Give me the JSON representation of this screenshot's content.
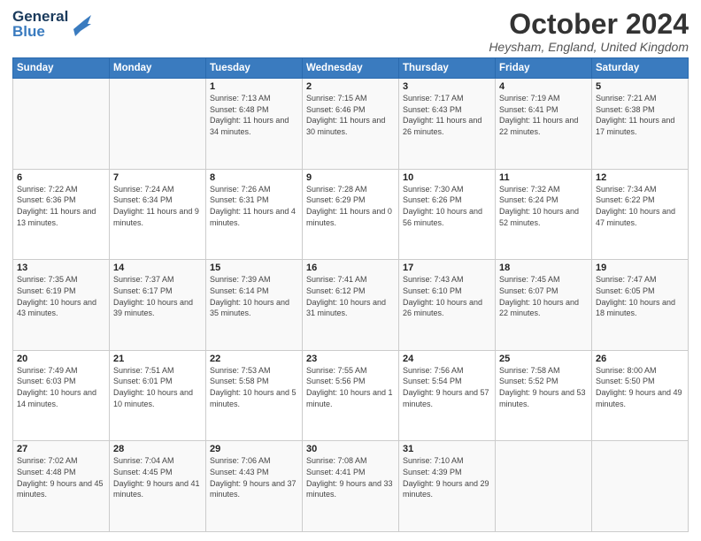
{
  "header": {
    "logo_line1": "General",
    "logo_line2": "Blue",
    "month_title": "October 2024",
    "location": "Heysham, England, United Kingdom"
  },
  "days_of_week": [
    "Sunday",
    "Monday",
    "Tuesday",
    "Wednesday",
    "Thursday",
    "Friday",
    "Saturday"
  ],
  "weeks": [
    [
      {
        "day": "",
        "sunrise": "",
        "sunset": "",
        "daylight": ""
      },
      {
        "day": "",
        "sunrise": "",
        "sunset": "",
        "daylight": ""
      },
      {
        "day": "1",
        "sunrise": "Sunrise: 7:13 AM",
        "sunset": "Sunset: 6:48 PM",
        "daylight": "Daylight: 11 hours and 34 minutes."
      },
      {
        "day": "2",
        "sunrise": "Sunrise: 7:15 AM",
        "sunset": "Sunset: 6:46 PM",
        "daylight": "Daylight: 11 hours and 30 minutes."
      },
      {
        "day": "3",
        "sunrise": "Sunrise: 7:17 AM",
        "sunset": "Sunset: 6:43 PM",
        "daylight": "Daylight: 11 hours and 26 minutes."
      },
      {
        "day": "4",
        "sunrise": "Sunrise: 7:19 AM",
        "sunset": "Sunset: 6:41 PM",
        "daylight": "Daylight: 11 hours and 22 minutes."
      },
      {
        "day": "5",
        "sunrise": "Sunrise: 7:21 AM",
        "sunset": "Sunset: 6:38 PM",
        "daylight": "Daylight: 11 hours and 17 minutes."
      }
    ],
    [
      {
        "day": "6",
        "sunrise": "Sunrise: 7:22 AM",
        "sunset": "Sunset: 6:36 PM",
        "daylight": "Daylight: 11 hours and 13 minutes."
      },
      {
        "day": "7",
        "sunrise": "Sunrise: 7:24 AM",
        "sunset": "Sunset: 6:34 PM",
        "daylight": "Daylight: 11 hours and 9 minutes."
      },
      {
        "day": "8",
        "sunrise": "Sunrise: 7:26 AM",
        "sunset": "Sunset: 6:31 PM",
        "daylight": "Daylight: 11 hours and 4 minutes."
      },
      {
        "day": "9",
        "sunrise": "Sunrise: 7:28 AM",
        "sunset": "Sunset: 6:29 PM",
        "daylight": "Daylight: 11 hours and 0 minutes."
      },
      {
        "day": "10",
        "sunrise": "Sunrise: 7:30 AM",
        "sunset": "Sunset: 6:26 PM",
        "daylight": "Daylight: 10 hours and 56 minutes."
      },
      {
        "day": "11",
        "sunrise": "Sunrise: 7:32 AM",
        "sunset": "Sunset: 6:24 PM",
        "daylight": "Daylight: 10 hours and 52 minutes."
      },
      {
        "day": "12",
        "sunrise": "Sunrise: 7:34 AM",
        "sunset": "Sunset: 6:22 PM",
        "daylight": "Daylight: 10 hours and 47 minutes."
      }
    ],
    [
      {
        "day": "13",
        "sunrise": "Sunrise: 7:35 AM",
        "sunset": "Sunset: 6:19 PM",
        "daylight": "Daylight: 10 hours and 43 minutes."
      },
      {
        "day": "14",
        "sunrise": "Sunrise: 7:37 AM",
        "sunset": "Sunset: 6:17 PM",
        "daylight": "Daylight: 10 hours and 39 minutes."
      },
      {
        "day": "15",
        "sunrise": "Sunrise: 7:39 AM",
        "sunset": "Sunset: 6:14 PM",
        "daylight": "Daylight: 10 hours and 35 minutes."
      },
      {
        "day": "16",
        "sunrise": "Sunrise: 7:41 AM",
        "sunset": "Sunset: 6:12 PM",
        "daylight": "Daylight: 10 hours and 31 minutes."
      },
      {
        "day": "17",
        "sunrise": "Sunrise: 7:43 AM",
        "sunset": "Sunset: 6:10 PM",
        "daylight": "Daylight: 10 hours and 26 minutes."
      },
      {
        "day": "18",
        "sunrise": "Sunrise: 7:45 AM",
        "sunset": "Sunset: 6:07 PM",
        "daylight": "Daylight: 10 hours and 22 minutes."
      },
      {
        "day": "19",
        "sunrise": "Sunrise: 7:47 AM",
        "sunset": "Sunset: 6:05 PM",
        "daylight": "Daylight: 10 hours and 18 minutes."
      }
    ],
    [
      {
        "day": "20",
        "sunrise": "Sunrise: 7:49 AM",
        "sunset": "Sunset: 6:03 PM",
        "daylight": "Daylight: 10 hours and 14 minutes."
      },
      {
        "day": "21",
        "sunrise": "Sunrise: 7:51 AM",
        "sunset": "Sunset: 6:01 PM",
        "daylight": "Daylight: 10 hours and 10 minutes."
      },
      {
        "day": "22",
        "sunrise": "Sunrise: 7:53 AM",
        "sunset": "Sunset: 5:58 PM",
        "daylight": "Daylight: 10 hours and 5 minutes."
      },
      {
        "day": "23",
        "sunrise": "Sunrise: 7:55 AM",
        "sunset": "Sunset: 5:56 PM",
        "daylight": "Daylight: 10 hours and 1 minute."
      },
      {
        "day": "24",
        "sunrise": "Sunrise: 7:56 AM",
        "sunset": "Sunset: 5:54 PM",
        "daylight": "Daylight: 9 hours and 57 minutes."
      },
      {
        "day": "25",
        "sunrise": "Sunrise: 7:58 AM",
        "sunset": "Sunset: 5:52 PM",
        "daylight": "Daylight: 9 hours and 53 minutes."
      },
      {
        "day": "26",
        "sunrise": "Sunrise: 8:00 AM",
        "sunset": "Sunset: 5:50 PM",
        "daylight": "Daylight: 9 hours and 49 minutes."
      }
    ],
    [
      {
        "day": "27",
        "sunrise": "Sunrise: 7:02 AM",
        "sunset": "Sunset: 4:48 PM",
        "daylight": "Daylight: 9 hours and 45 minutes."
      },
      {
        "day": "28",
        "sunrise": "Sunrise: 7:04 AM",
        "sunset": "Sunset: 4:45 PM",
        "daylight": "Daylight: 9 hours and 41 minutes."
      },
      {
        "day": "29",
        "sunrise": "Sunrise: 7:06 AM",
        "sunset": "Sunset: 4:43 PM",
        "daylight": "Daylight: 9 hours and 37 minutes."
      },
      {
        "day": "30",
        "sunrise": "Sunrise: 7:08 AM",
        "sunset": "Sunset: 4:41 PM",
        "daylight": "Daylight: 9 hours and 33 minutes."
      },
      {
        "day": "31",
        "sunrise": "Sunrise: 7:10 AM",
        "sunset": "Sunset: 4:39 PM",
        "daylight": "Daylight: 9 hours and 29 minutes."
      },
      {
        "day": "",
        "sunrise": "",
        "sunset": "",
        "daylight": ""
      },
      {
        "day": "",
        "sunrise": "",
        "sunset": "",
        "daylight": ""
      }
    ]
  ]
}
